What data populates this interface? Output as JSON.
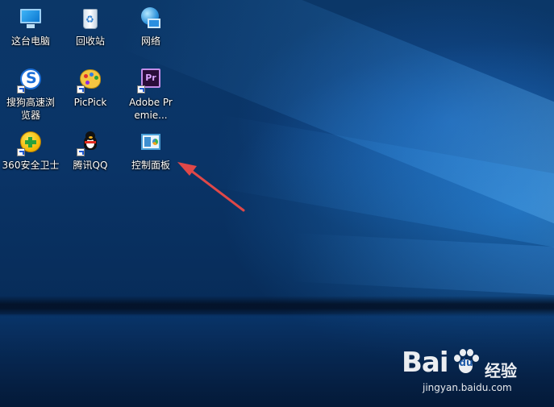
{
  "desktop": {
    "icons": [
      {
        "label": "这台电脑",
        "icon": "computer-icon"
      },
      {
        "label": "回收站",
        "icon": "recycle-bin-icon"
      },
      {
        "label": "网络",
        "icon": "network-icon"
      },
      {
        "label": "搜狗高速浏览器",
        "icon": "sogou-browser-icon"
      },
      {
        "label": "PicPick",
        "icon": "picpick-icon"
      },
      {
        "label": "Adobe Premie...",
        "icon": "adobe-premiere-icon"
      },
      {
        "label": "360安全卫士",
        "icon": "360-security-icon"
      },
      {
        "label": "腾讯QQ",
        "icon": "qq-icon"
      },
      {
        "label": "控制面板",
        "icon": "control-panel-icon"
      }
    ]
  },
  "annotation": {
    "icon": "red-arrow-icon",
    "color": "#e04848"
  },
  "watermark": {
    "brand": "Bai",
    "paw_text": "du",
    "product": "经验",
    "url": "jingyan.baidu.com"
  },
  "colors": {
    "wallpaper": "#0a3467",
    "label_text": "#ffffff"
  }
}
